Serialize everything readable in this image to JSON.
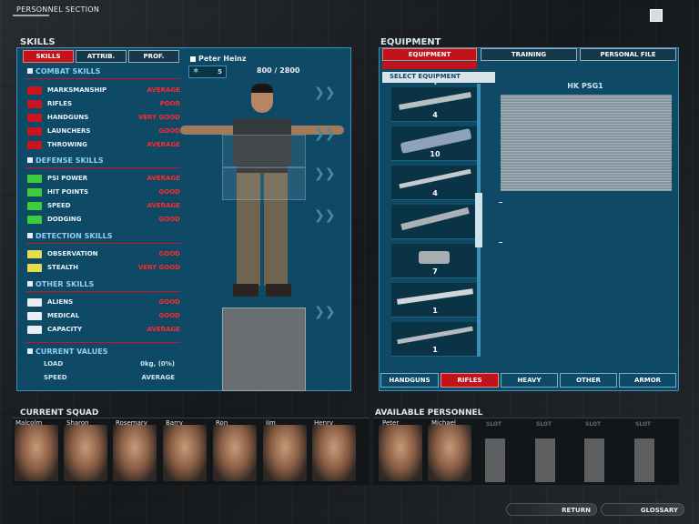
{
  "header": {
    "title": "PERSONNEL SECTION"
  },
  "skills_panel": {
    "title": "SKILLS",
    "tabs": [
      {
        "label": "SKILLS",
        "active": true
      },
      {
        "label": "ATTRIB.",
        "active": false
      },
      {
        "label": "PROF.",
        "active": false
      }
    ],
    "groups": [
      {
        "name": "COMBAT SKILLS",
        "items": [
          {
            "label": "MARKSMANSHIP",
            "value": "AVERAGE",
            "color": "#c8161c"
          },
          {
            "label": "RIFLES",
            "value": "POOR",
            "color": "#c8161c"
          },
          {
            "label": "HANDGUNS",
            "value": "VERY GOOD",
            "color": "#c8161c"
          },
          {
            "label": "LAUNCHERS",
            "value": "GOOD",
            "color": "#c8161c"
          },
          {
            "label": "THROWING",
            "value": "AVERAGE",
            "color": "#c8161c"
          }
        ]
      },
      {
        "name": "DEFENSE SKILLS",
        "items": [
          {
            "label": "PSI POWER",
            "value": "AVERAGE",
            "color": "#3ecb3e"
          },
          {
            "label": "HIT POINTS",
            "value": "GOOD",
            "color": "#3ecb3e"
          },
          {
            "label": "SPEED",
            "value": "AVERAGE",
            "color": "#3ecb3e"
          },
          {
            "label": "DODGING",
            "value": "GOOD",
            "color": "#3ecb3e"
          }
        ]
      },
      {
        "name": "DETECTION SKILLS",
        "items": [
          {
            "label": "OBSERVATION",
            "value": "GOOD",
            "color": "#e6de4a"
          },
          {
            "label": "STEALTH",
            "value": "VERY GOOD",
            "color": "#e6de4a"
          }
        ]
      },
      {
        "name": "OTHER SKILLS",
        "items": [
          {
            "label": "ALIENS",
            "value": "GOOD",
            "color": "#e8eef2"
          },
          {
            "label": "MEDICAL",
            "value": "GOOD",
            "color": "#e8eef2"
          },
          {
            "label": "CAPACITY",
            "value": "AVERAGE",
            "color": "#e8eef2"
          }
        ]
      }
    ],
    "current_values": {
      "title": "CURRENT VALUES",
      "load_label": "LOAD",
      "load_value": "0kg, (0%)",
      "speed_label": "SPEED",
      "speed_value": "AVERAGE"
    }
  },
  "character": {
    "name": "Peter Heinz",
    "rank_value": "5",
    "points": "800 / 2800"
  },
  "equipment_panel": {
    "title": "EQUIPMENT",
    "tabs": [
      {
        "label": "EQUIPMENT",
        "active": true
      },
      {
        "label": "TRAINING",
        "active": false
      },
      {
        "label": "PERSONAL FILE",
        "active": false
      }
    ],
    "select_label": "SELECT EQUIPMENT",
    "top_count": "7",
    "items": [
      {
        "count": "4",
        "icon": "rifle-icon"
      },
      {
        "count": "10",
        "icon": "assault-rifle-icon"
      },
      {
        "count": "4",
        "icon": "sniper-rifle-icon"
      },
      {
        "count": "",
        "icon": "shotgun-icon"
      },
      {
        "count": "7",
        "icon": "pistol-icon"
      },
      {
        "count": "1",
        "icon": "scoped-rifle-icon"
      },
      {
        "count": "1",
        "icon": "long-rifle-icon"
      }
    ],
    "selected_name": "HK PSG1",
    "categories": [
      {
        "label": "HANDGUNS",
        "active": false
      },
      {
        "label": "RIFLES",
        "active": true
      },
      {
        "label": "HEAVY",
        "active": false
      },
      {
        "label": "OTHER",
        "active": false
      },
      {
        "label": "ARMOR",
        "active": false
      }
    ]
  },
  "current_squad": {
    "title": "CURRENT SQUAD",
    "members": [
      "Malcolm",
      "Sharon",
      "Rosemary",
      "Barry",
      "Ron",
      "Jim",
      "Henry"
    ]
  },
  "available_personnel": {
    "title": "AVAILABLE PERSONNEL",
    "members": [
      "Peter",
      "Michael"
    ],
    "slots": [
      "SLOT",
      "SLOT",
      "SLOT",
      "SLOT"
    ]
  },
  "footer": {
    "return_label": "RETURN",
    "glossary_label": "GLOSSARY"
  }
}
